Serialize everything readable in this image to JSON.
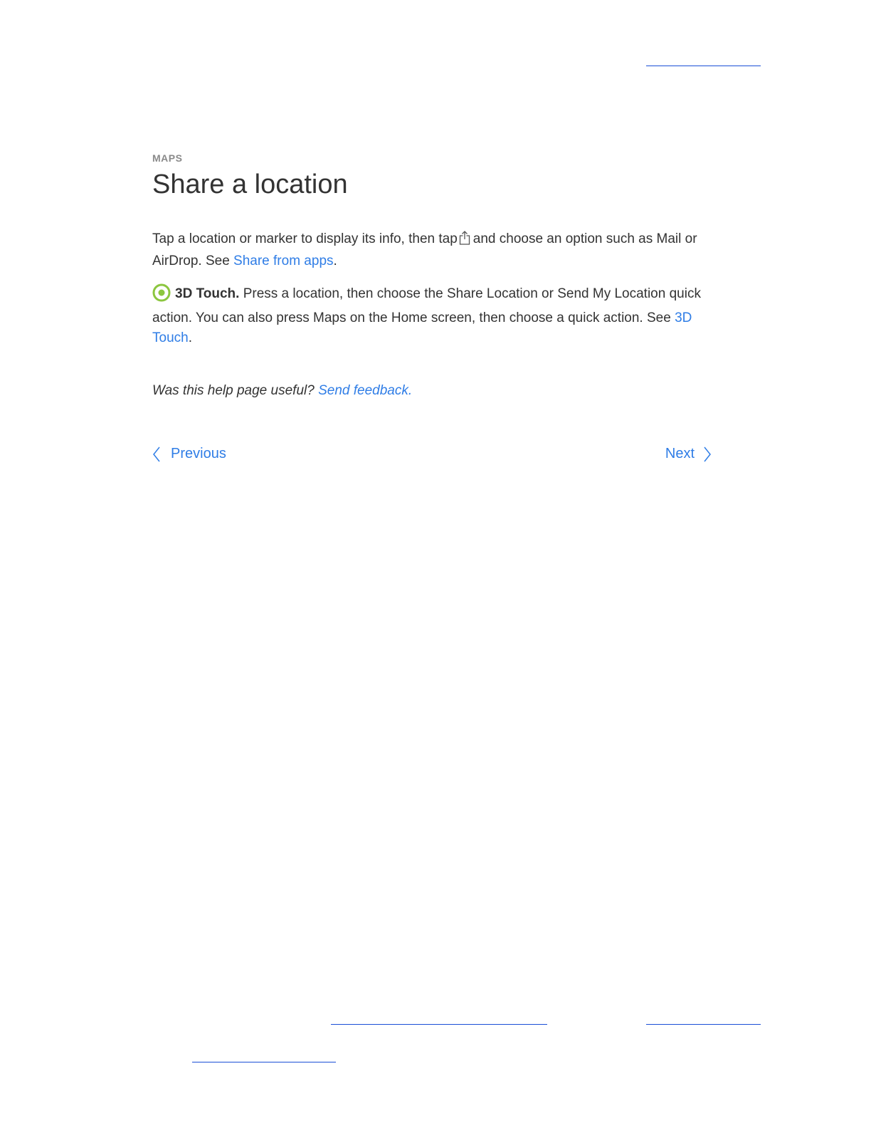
{
  "page": {
    "section_label": "MAPS",
    "title": "Share a location"
  },
  "paragraph1": {
    "text_before_icon": "Tap a location or marker to display its info, then tap",
    "icon": "share-icon",
    "text_after_icon": "and choose an option such as Mail or AirDrop. See ",
    "link_text": "Share from apps",
    "text_end": "."
  },
  "paragraph2": {
    "icon": "3d-touch-icon",
    "icon_color": "#8cc63f",
    "bold_label": "3D Touch.",
    "text": " Press a location, then choose the Share Location or Send My Location quick action. You can also press Maps on the Home screen, then choose a quick action. See ",
    "link_text": "3D Touch",
    "text_end": "."
  },
  "feedback": {
    "question": "Was this help page useful?",
    "link_text": "Send feedback",
    "text_end": "."
  },
  "navigation": {
    "previous_label": "Previous",
    "next_label": "Next"
  },
  "colors": {
    "link": "#2f7de6",
    "text": "#333333",
    "eyebrow": "#8a8a8a",
    "rule": "#1a4fd6"
  }
}
